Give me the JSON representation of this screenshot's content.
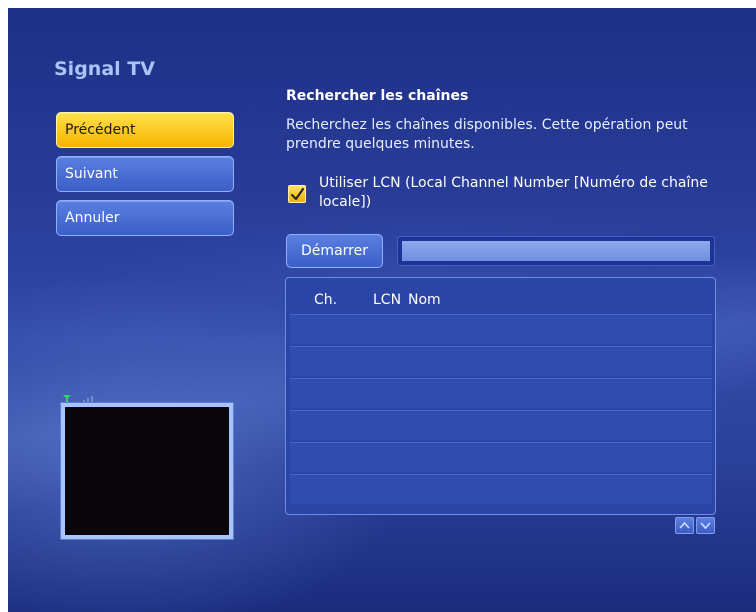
{
  "app": {
    "title": "Signal TV"
  },
  "nav": {
    "buttons": [
      {
        "label": "Précédent",
        "state": "focused"
      },
      {
        "label": "Suivant"
      },
      {
        "label": "Annuler"
      }
    ]
  },
  "search": {
    "title": "Rechercher les chaînes",
    "description": "Recherchez les chaînes disponibles. Cette opération peut prendre quelques minutes.",
    "lcn_checkbox": {
      "label": "Utiliser LCN (Local Channel Number [Numéro de chaîne locale])",
      "checked": true
    },
    "start_label": "Démarrer",
    "progress": 1.0
  },
  "table": {
    "columns": [
      "Ch.",
      "LCN",
      "Nom"
    ],
    "rows": [
      [],
      [],
      [],
      [],
      [],
      []
    ]
  },
  "icons": {
    "check": "checkmark-icon",
    "signal": "signal-strength-icon",
    "scroll_up": "chevron-up-icon",
    "scroll_down": "chevron-down-icon"
  },
  "colors": {
    "background": "#2a3e9a",
    "focus": "#f7b400",
    "button": "#3c5ec8",
    "signal": "#33d36a"
  }
}
